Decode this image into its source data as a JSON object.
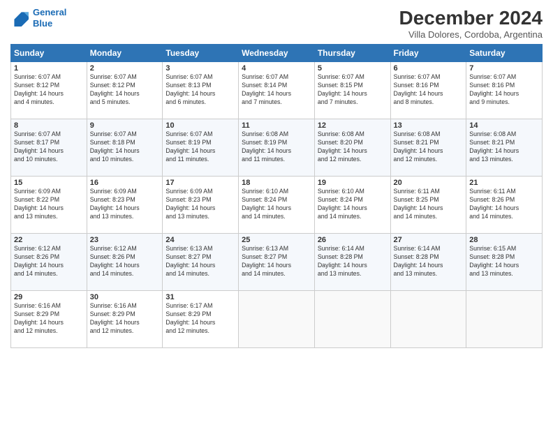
{
  "header": {
    "logo_line1": "General",
    "logo_line2": "Blue",
    "month": "December 2024",
    "location": "Villa Dolores, Cordoba, Argentina"
  },
  "days_of_week": [
    "Sunday",
    "Monday",
    "Tuesday",
    "Wednesday",
    "Thursday",
    "Friday",
    "Saturday"
  ],
  "weeks": [
    [
      {
        "day": "1",
        "lines": [
          "Sunrise: 6:07 AM",
          "Sunset: 8:12 PM",
          "Daylight: 14 hours",
          "and 4 minutes."
        ]
      },
      {
        "day": "2",
        "lines": [
          "Sunrise: 6:07 AM",
          "Sunset: 8:12 PM",
          "Daylight: 14 hours",
          "and 5 minutes."
        ]
      },
      {
        "day": "3",
        "lines": [
          "Sunrise: 6:07 AM",
          "Sunset: 8:13 PM",
          "Daylight: 14 hours",
          "and 6 minutes."
        ]
      },
      {
        "day": "4",
        "lines": [
          "Sunrise: 6:07 AM",
          "Sunset: 8:14 PM",
          "Daylight: 14 hours",
          "and 7 minutes."
        ]
      },
      {
        "day": "5",
        "lines": [
          "Sunrise: 6:07 AM",
          "Sunset: 8:15 PM",
          "Daylight: 14 hours",
          "and 7 minutes."
        ]
      },
      {
        "day": "6",
        "lines": [
          "Sunrise: 6:07 AM",
          "Sunset: 8:16 PM",
          "Daylight: 14 hours",
          "and 8 minutes."
        ]
      },
      {
        "day": "7",
        "lines": [
          "Sunrise: 6:07 AM",
          "Sunset: 8:16 PM",
          "Daylight: 14 hours",
          "and 9 minutes."
        ]
      }
    ],
    [
      {
        "day": "8",
        "lines": [
          "Sunrise: 6:07 AM",
          "Sunset: 8:17 PM",
          "Daylight: 14 hours",
          "and 10 minutes."
        ]
      },
      {
        "day": "9",
        "lines": [
          "Sunrise: 6:07 AM",
          "Sunset: 8:18 PM",
          "Daylight: 14 hours",
          "and 10 minutes."
        ]
      },
      {
        "day": "10",
        "lines": [
          "Sunrise: 6:07 AM",
          "Sunset: 8:19 PM",
          "Daylight: 14 hours",
          "and 11 minutes."
        ]
      },
      {
        "day": "11",
        "lines": [
          "Sunrise: 6:08 AM",
          "Sunset: 8:19 PM",
          "Daylight: 14 hours",
          "and 11 minutes."
        ]
      },
      {
        "day": "12",
        "lines": [
          "Sunrise: 6:08 AM",
          "Sunset: 8:20 PM",
          "Daylight: 14 hours",
          "and 12 minutes."
        ]
      },
      {
        "day": "13",
        "lines": [
          "Sunrise: 6:08 AM",
          "Sunset: 8:21 PM",
          "Daylight: 14 hours",
          "and 12 minutes."
        ]
      },
      {
        "day": "14",
        "lines": [
          "Sunrise: 6:08 AM",
          "Sunset: 8:21 PM",
          "Daylight: 14 hours",
          "and 13 minutes."
        ]
      }
    ],
    [
      {
        "day": "15",
        "lines": [
          "Sunrise: 6:09 AM",
          "Sunset: 8:22 PM",
          "Daylight: 14 hours",
          "and 13 minutes."
        ]
      },
      {
        "day": "16",
        "lines": [
          "Sunrise: 6:09 AM",
          "Sunset: 8:23 PM",
          "Daylight: 14 hours",
          "and 13 minutes."
        ]
      },
      {
        "day": "17",
        "lines": [
          "Sunrise: 6:09 AM",
          "Sunset: 8:23 PM",
          "Daylight: 14 hours",
          "and 13 minutes."
        ]
      },
      {
        "day": "18",
        "lines": [
          "Sunrise: 6:10 AM",
          "Sunset: 8:24 PM",
          "Daylight: 14 hours",
          "and 14 minutes."
        ]
      },
      {
        "day": "19",
        "lines": [
          "Sunrise: 6:10 AM",
          "Sunset: 8:24 PM",
          "Daylight: 14 hours",
          "and 14 minutes."
        ]
      },
      {
        "day": "20",
        "lines": [
          "Sunrise: 6:11 AM",
          "Sunset: 8:25 PM",
          "Daylight: 14 hours",
          "and 14 minutes."
        ]
      },
      {
        "day": "21",
        "lines": [
          "Sunrise: 6:11 AM",
          "Sunset: 8:26 PM",
          "Daylight: 14 hours",
          "and 14 minutes."
        ]
      }
    ],
    [
      {
        "day": "22",
        "lines": [
          "Sunrise: 6:12 AM",
          "Sunset: 8:26 PM",
          "Daylight: 14 hours",
          "and 14 minutes."
        ]
      },
      {
        "day": "23",
        "lines": [
          "Sunrise: 6:12 AM",
          "Sunset: 8:26 PM",
          "Daylight: 14 hours",
          "and 14 minutes."
        ]
      },
      {
        "day": "24",
        "lines": [
          "Sunrise: 6:13 AM",
          "Sunset: 8:27 PM",
          "Daylight: 14 hours",
          "and 14 minutes."
        ]
      },
      {
        "day": "25",
        "lines": [
          "Sunrise: 6:13 AM",
          "Sunset: 8:27 PM",
          "Daylight: 14 hours",
          "and 14 minutes."
        ]
      },
      {
        "day": "26",
        "lines": [
          "Sunrise: 6:14 AM",
          "Sunset: 8:28 PM",
          "Daylight: 14 hours",
          "and 13 minutes."
        ]
      },
      {
        "day": "27",
        "lines": [
          "Sunrise: 6:14 AM",
          "Sunset: 8:28 PM",
          "Daylight: 14 hours",
          "and 13 minutes."
        ]
      },
      {
        "day": "28",
        "lines": [
          "Sunrise: 6:15 AM",
          "Sunset: 8:28 PM",
          "Daylight: 14 hours",
          "and 13 minutes."
        ]
      }
    ],
    [
      {
        "day": "29",
        "lines": [
          "Sunrise: 6:16 AM",
          "Sunset: 8:29 PM",
          "Daylight: 14 hours",
          "and 12 minutes."
        ]
      },
      {
        "day": "30",
        "lines": [
          "Sunrise: 6:16 AM",
          "Sunset: 8:29 PM",
          "Daylight: 14 hours",
          "and 12 minutes."
        ]
      },
      {
        "day": "31",
        "lines": [
          "Sunrise: 6:17 AM",
          "Sunset: 8:29 PM",
          "Daylight: 14 hours",
          "and 12 minutes."
        ]
      },
      null,
      null,
      null,
      null
    ]
  ]
}
